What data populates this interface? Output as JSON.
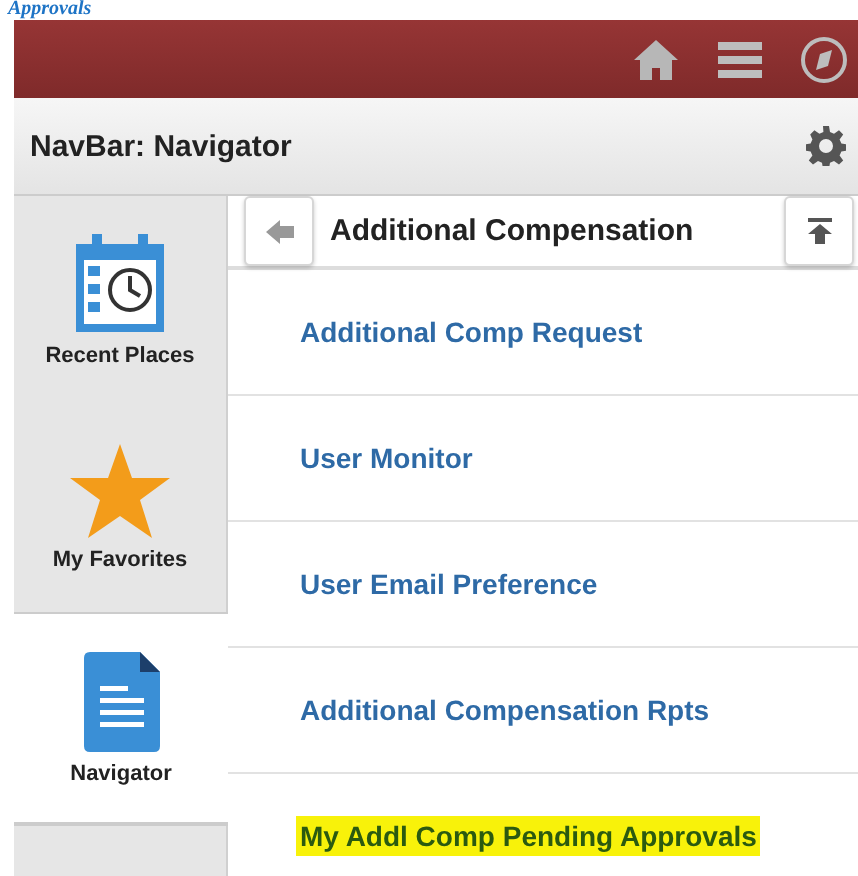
{
  "page_heading": "Approvals",
  "navbar": {
    "title": "NavBar: Navigator"
  },
  "sidebar": {
    "items": [
      {
        "label": "Recent Places",
        "selected": false
      },
      {
        "label": "My Favorites",
        "selected": false
      },
      {
        "label": "Navigator",
        "selected": true
      }
    ]
  },
  "folder": {
    "title": "Additional Compensation",
    "items": [
      {
        "label": "Additional Comp Request",
        "highlighted": false
      },
      {
        "label": "User Monitor",
        "highlighted": false
      },
      {
        "label": "User Email Preference",
        "highlighted": false
      },
      {
        "label": "Additional Compensation Rpts",
        "highlighted": false
      },
      {
        "label": "My Addl Comp Pending Approvals",
        "highlighted": true
      }
    ]
  }
}
